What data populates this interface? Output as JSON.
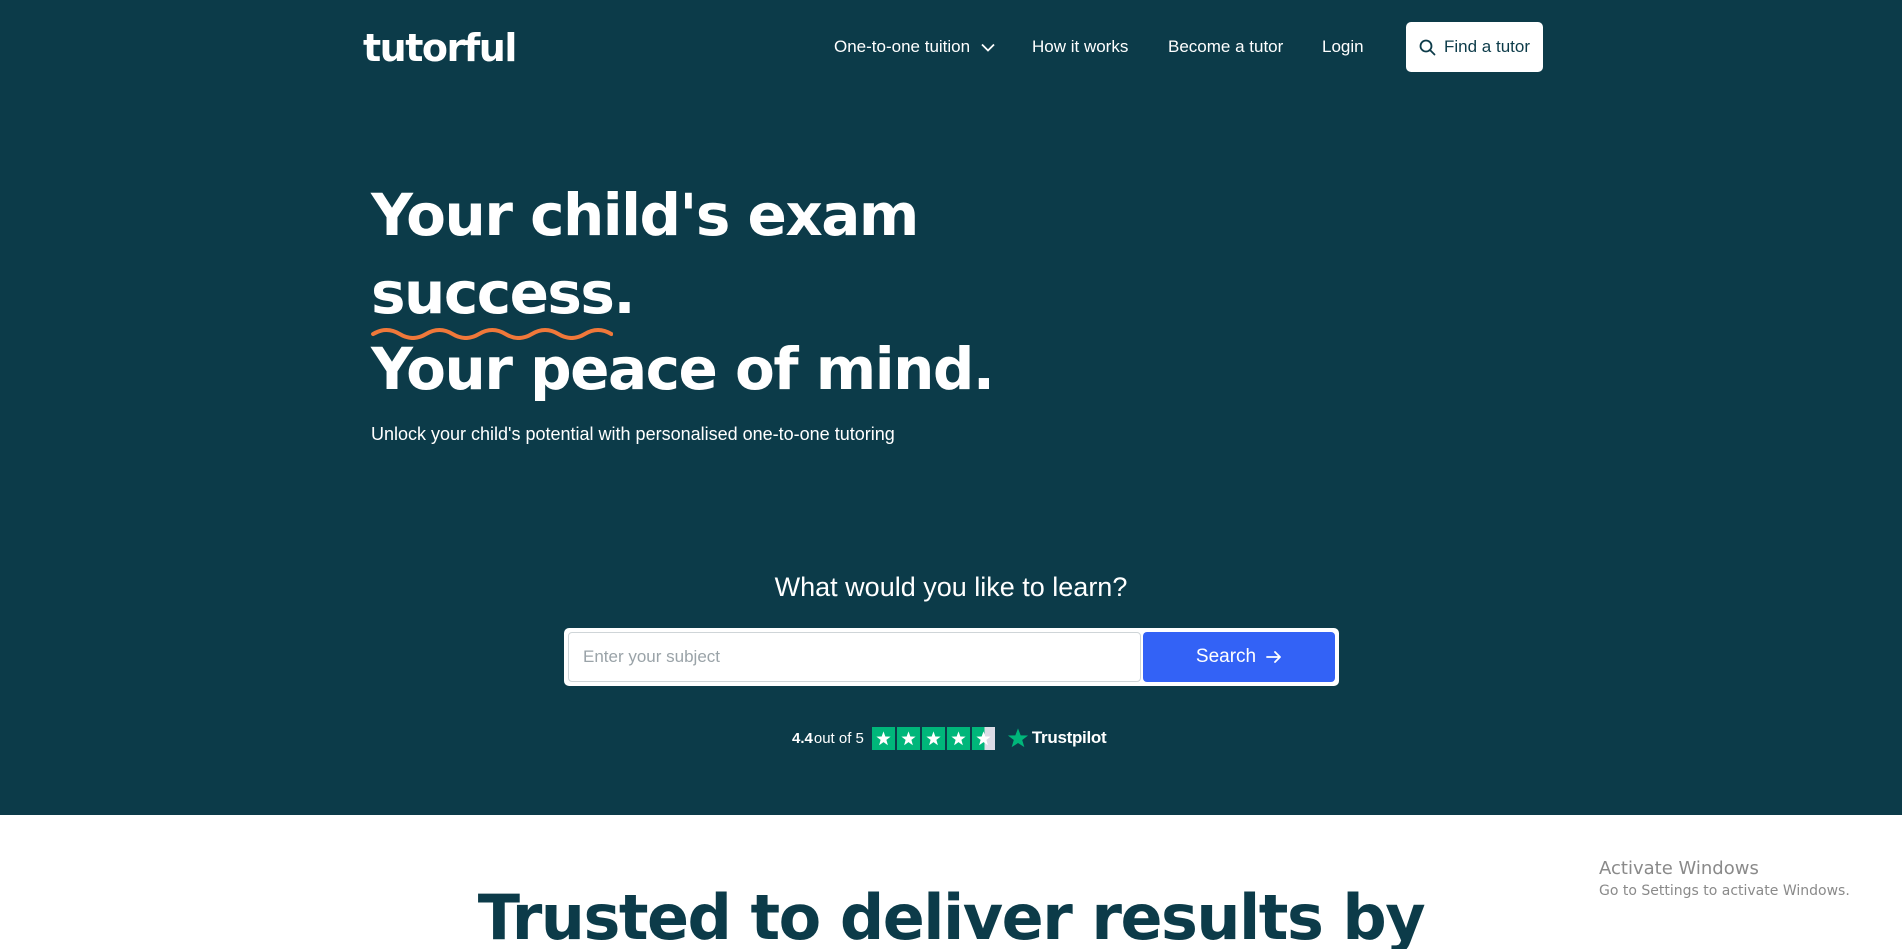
{
  "header": {
    "logo": "tutorful",
    "nav": [
      "One-to-one tuition",
      "How it works",
      "Become a tutor",
      "Login"
    ],
    "find_tutor": "Find a tutor"
  },
  "hero": {
    "line1": "Your child's exam",
    "line2_word": "success",
    "line2_punct": ".",
    "line3": "Your peace of mind.",
    "subline": "Unlock your child's potential with personalised one-to-one tutoring",
    "search_question": "What would you like to learn?",
    "search_placeholder": "Enter your subject",
    "search_button": "Search"
  },
  "trustpilot": {
    "rating": "4.4",
    "out_of": "out of 5",
    "stars_filled": 4.5,
    "brand": "Trustpilot"
  },
  "section": {
    "heading": "Trusted to deliver results by"
  },
  "watermark": {
    "title": "Activate Windows",
    "subtitle": "Go to Settings to activate Windows."
  },
  "colors": {
    "hero_bg": "#0c3b49",
    "accent_orange": "#f0783a",
    "search_blue": "#3362f6",
    "trustpilot_green": "#00b67a"
  }
}
